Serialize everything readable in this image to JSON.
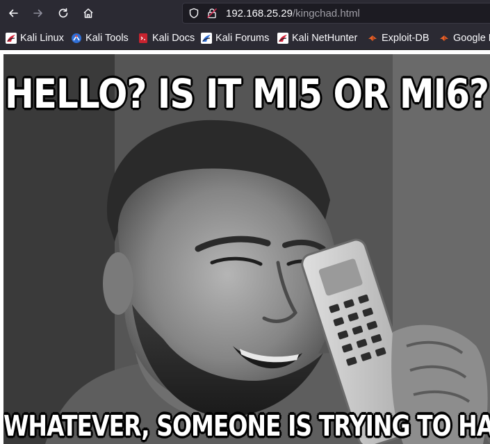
{
  "browser": {
    "url_host": "192.168.25.29",
    "url_path": "/kingchad.html",
    "icons": {
      "back": "arrow-left-icon",
      "forward": "arrow-right-icon",
      "reload": "reload-icon",
      "home": "home-icon",
      "tracking_protection": "shield-icon",
      "connection": "lock-icon"
    },
    "bookmarks": [
      {
        "label": "Kali Linux",
        "icon": "kali-dragon-icon"
      },
      {
        "label": "Kali Tools",
        "icon": "kali-tools-icon"
      },
      {
        "label": "Kali Docs",
        "icon": "kali-docs-icon"
      },
      {
        "label": "Kali Forums",
        "icon": "kali-forums-icon"
      },
      {
        "label": "Kali NetHunter",
        "icon": "kali-nethunter-icon"
      },
      {
        "label": "Exploit-DB",
        "icon": "exploit-db-icon"
      },
      {
        "label": "Google H",
        "icon": "google-hacking-icon"
      }
    ]
  },
  "meme": {
    "top_caption": "HELLO? IS IT MI5 OR MI6?",
    "bottom_caption": "WHATEVER, SOMEONE IS TRYING TO HACK US"
  },
  "colors": {
    "toolbar": "#2b2a33",
    "urlbar": "#1c1b22",
    "text": "#fbfbfe",
    "url_path": "#9f9ea6",
    "kali_red": "#d7263d",
    "exploit_orange": "#e8622a"
  }
}
